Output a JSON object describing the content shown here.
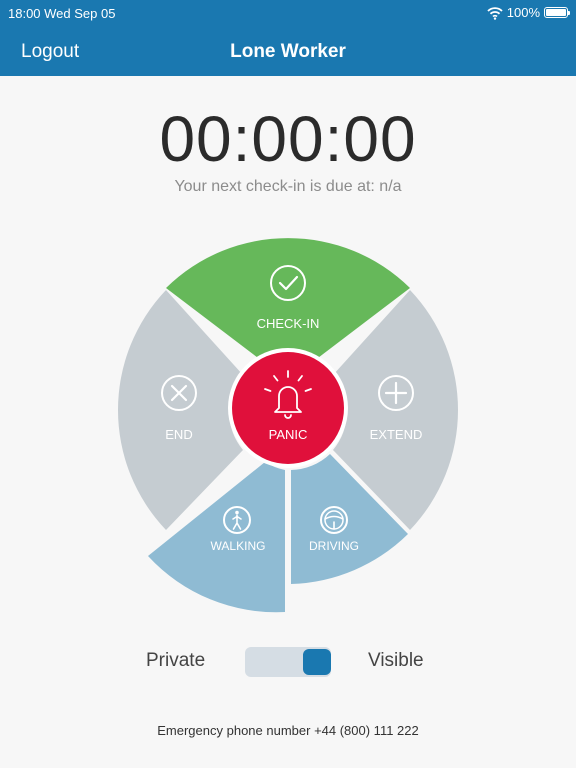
{
  "status_bar": {
    "time": "18:00 Wed Sep 05",
    "battery": "100%"
  },
  "nav": {
    "logout_label": "Logout",
    "title": "Lone Worker"
  },
  "timer": {
    "value": "00:00:00",
    "next_checkin": "Your next check-in is due at: n/a"
  },
  "dial": {
    "checkin_label": "CHECK-IN",
    "end_label": "END",
    "extend_label": "EXTEND",
    "panic_label": "PANIC",
    "walking_label": "WALKING",
    "driving_label": "DRIVING"
  },
  "visibility": {
    "private_label": "Private",
    "visible_label": "Visible",
    "is_visible": true
  },
  "emergency": {
    "text": "Emergency phone number +44 (800) 111 222"
  },
  "colors": {
    "brand_blue": "#1a78b0",
    "checkin_green": "#66b85a",
    "panic_red": "#e0103b",
    "grey_segment": "#c5ccd1",
    "mode_blue": "#8fbbd3"
  }
}
